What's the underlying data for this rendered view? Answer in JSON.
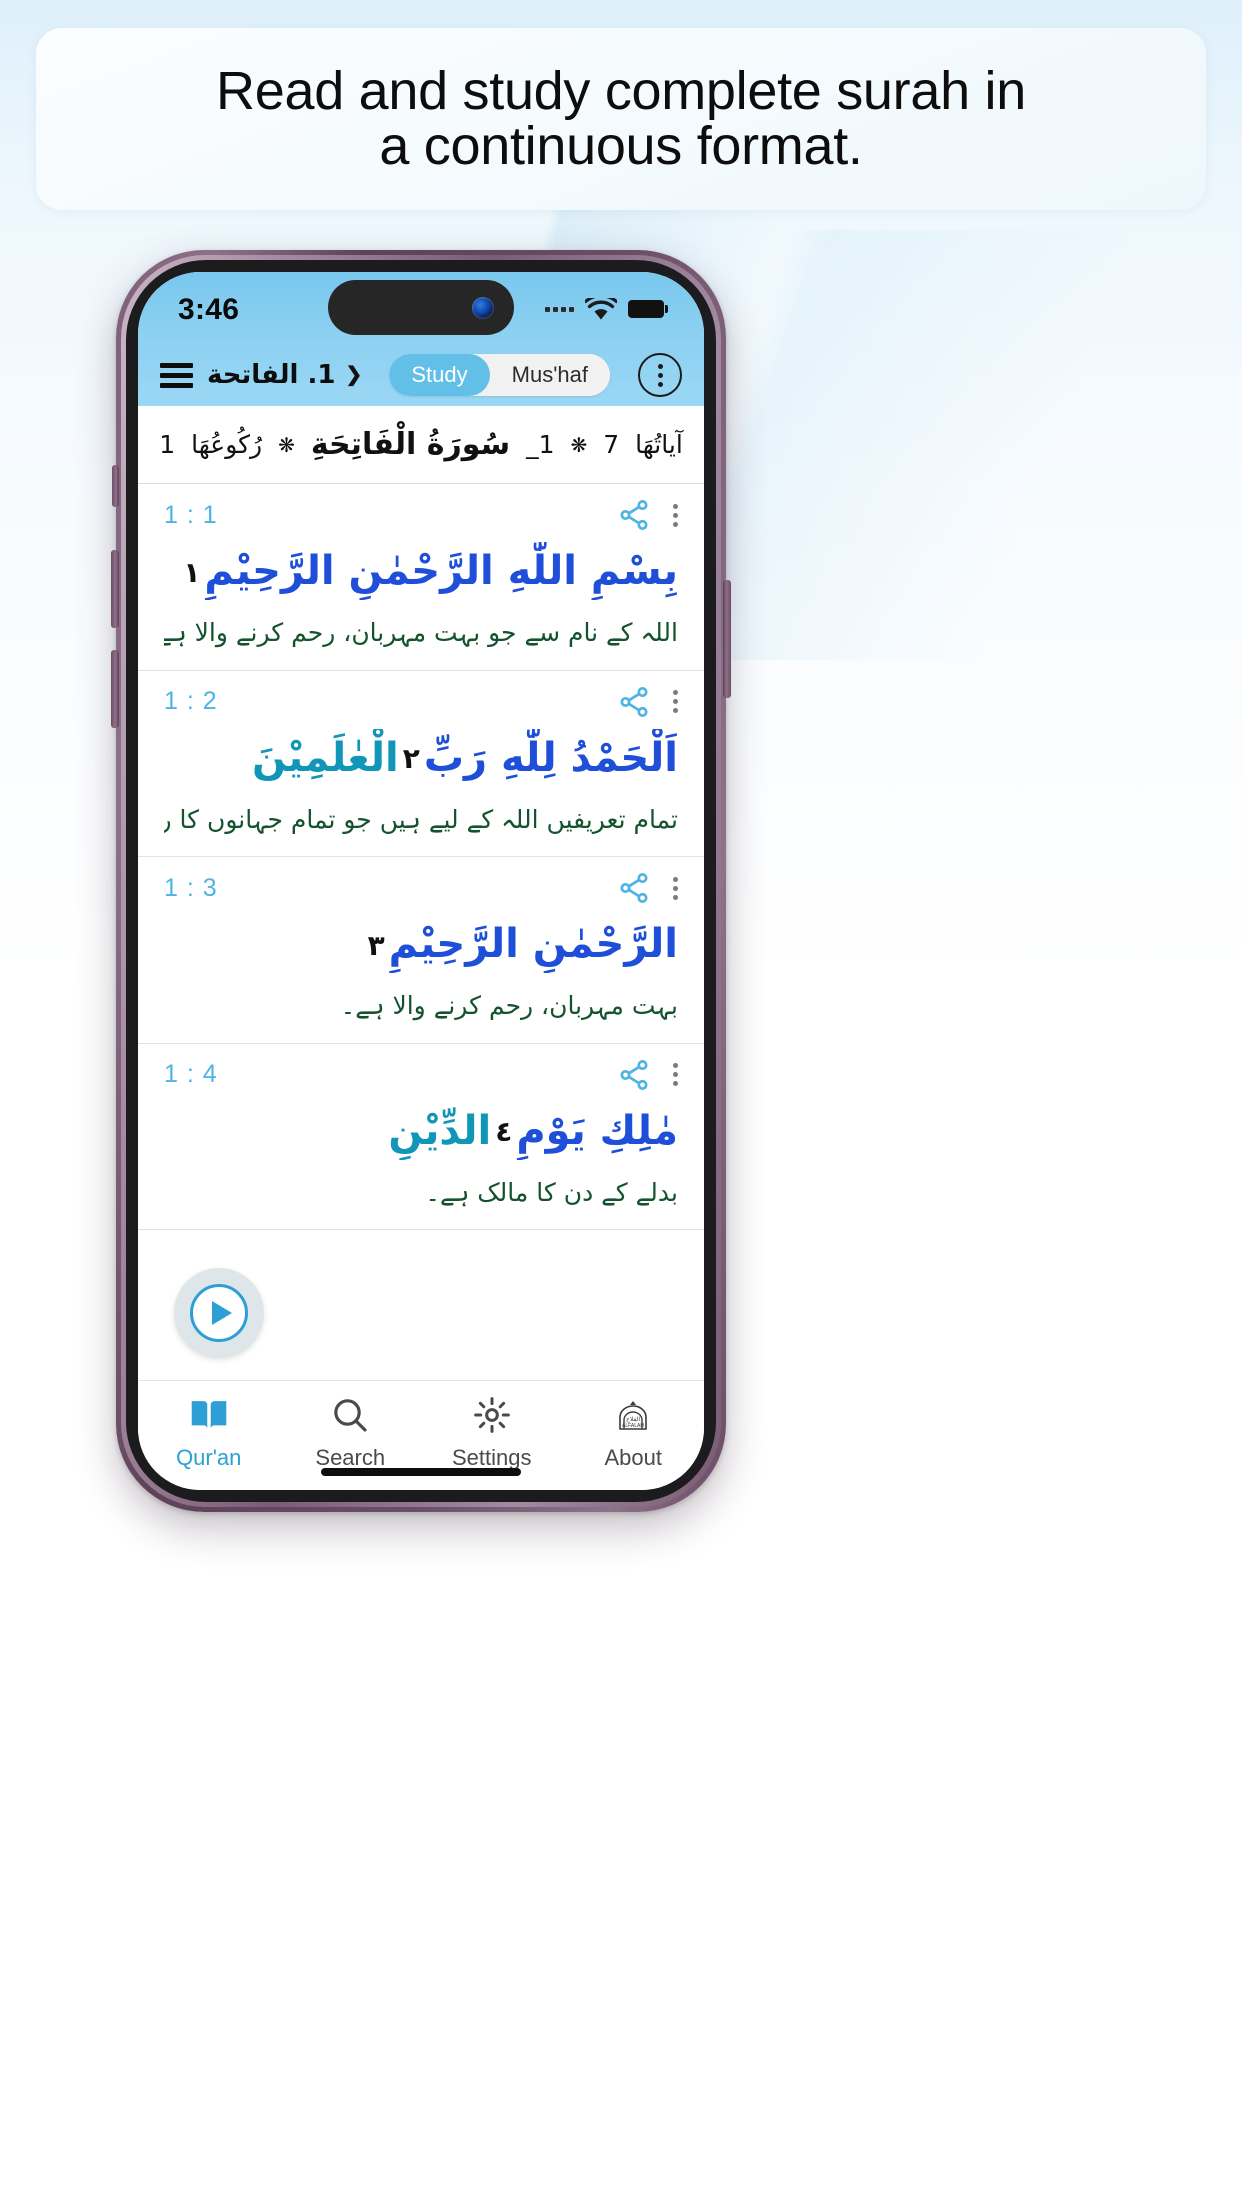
{
  "caption": {
    "line1": "Read and study complete surah in",
    "line2": "a continuous format."
  },
  "colors": {
    "accent": "#2e9fd4",
    "status_bar_blue": "#8fd2f2",
    "appbar_blue": "#9ad8f4",
    "arabic_blue": "#1f4fd8",
    "arabic_teal": "#1296b8",
    "urdu_green": "#14532d",
    "ayah_number": "#4db4e3",
    "bezel_purple": "#6b4d66"
  },
  "status_bar": {
    "time": "3:46",
    "signal_icon": "signal-dots-icon",
    "wifi_icon": "wifi-icon",
    "battery_icon": "battery-full-icon"
  },
  "app_bar": {
    "menu_icon": "hamburger-menu-icon",
    "surah_selector_label": "1. الفاتحة",
    "chevron_icon": "chevron-down-icon",
    "segments": [
      {
        "label": "Study",
        "active": true
      },
      {
        "label": "Mus'haf",
        "active": false
      }
    ],
    "overflow_icon": "kebab-menu-icon"
  },
  "surah_header": {
    "ayah_count_label": "آياتُهَا",
    "ayah_count": "7",
    "star_icon": "star-ornament-icon",
    "number": "1_",
    "title": "سُورَةُ الْفَاتِحَةِ",
    "ruku_label": "رُكُوعُهَا",
    "ruku_count": "1"
  },
  "ayahs": [
    {
      "ref": "1 : 1",
      "arabic_blue": "بِسْمِ اللّٰهِ الرَّحْمٰنِ الرَّحِيْمِ",
      "arabic_teal": "",
      "marker": "١",
      "urdu": "اللہ کے نام سے جو بہت مہربان، رحم کرنے والا ہے۔",
      "share_icon": "share-icon",
      "overflow_icon": "kebab-menu-icon"
    },
    {
      "ref": "1 : 2",
      "arabic_blue": "اَلْحَمْدُ لِلّٰهِ رَبِّ",
      "arabic_teal": "الْعٰلَمِيْنَ",
      "marker": "٢",
      "urdu": "تمام تعریفیں اللہ کے لیے ہیں جو تمام جہانوں کا رب ہے۔",
      "share_icon": "share-icon",
      "overflow_icon": "kebab-menu-icon"
    },
    {
      "ref": "1 : 3",
      "arabic_blue": "الرَّحْمٰنِ الرَّحِيْمِ",
      "arabic_teal": "",
      "marker": "٣",
      "urdu": "بہت مہربان، رحم کرنے والا ہے۔",
      "share_icon": "share-icon",
      "overflow_icon": "kebab-menu-icon"
    },
    {
      "ref": "1 : 4",
      "arabic_blue": "مٰلِكِ يَوْمِ",
      "arabic_teal": "الدِّيْنِ",
      "marker": "٤",
      "urdu": "بدلے کے دن کا مالک ہے۔",
      "share_icon": "share-icon",
      "overflow_icon": "kebab-menu-icon"
    }
  ],
  "play_button": {
    "icon": "play-icon"
  },
  "tabs": [
    {
      "label": "Qur'an",
      "icon": "book-icon",
      "active": true
    },
    {
      "label": "Search",
      "icon": "search-icon",
      "active": false
    },
    {
      "label": "Settings",
      "icon": "gear-icon",
      "active": false
    },
    {
      "label": "About",
      "icon": "alfalah-logo-icon",
      "active": false
    }
  ]
}
